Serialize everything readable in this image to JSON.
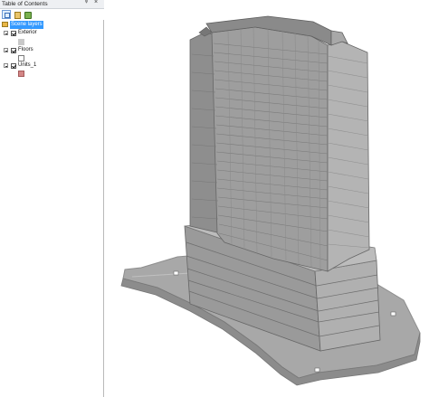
{
  "toc": {
    "title": "Table of Contents",
    "pin_glyph": "ᵠ",
    "close_glyph": "×",
    "group_label": "Scene layers",
    "layers": [
      {
        "name": "Exterior",
        "swatch": "#c8c8c8"
      },
      {
        "name": "Floors",
        "swatch": "#ffffff"
      },
      {
        "name": "Units_1",
        "swatch": "#d38686"
      }
    ]
  },
  "colors": {
    "selection": "#3399ff",
    "building_face": "#9b9b9b",
    "building_dark": "#7c7c7c",
    "building_light": "#b2b2b2",
    "base_plate": "#a6a6a6"
  }
}
